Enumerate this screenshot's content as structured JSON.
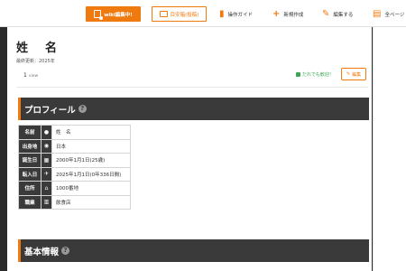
{
  "toolbar": {
    "wiki_label": "wiki編集中!",
    "notice_label": "目安箱(投稿)",
    "guide_label": "操作ガイド",
    "new_label": "新規作成",
    "edit_label": "編集する",
    "all_pages_label": "全ページ"
  },
  "page": {
    "title": "姓　名",
    "updated": "最終更新：2025年",
    "views_count": "1",
    "views_unit": "view",
    "anyone_label": "だれでも歓迎！",
    "edit_button": "編集"
  },
  "sections": {
    "profile_title": "プロフィール",
    "basic_title": "基本情報"
  },
  "profile": {
    "rows": [
      {
        "label": "名前",
        "icon": "person-icon",
        "value": "姓　名"
      },
      {
        "label": "出身地",
        "icon": "location-pin-icon",
        "value": "日本"
      },
      {
        "label": "誕生日",
        "icon": "calendar-icon",
        "value": "2000年1月1日(25歳)"
      },
      {
        "label": "転入日",
        "icon": "airplane-icon",
        "value": "2025年1月1日(0年336日間)"
      },
      {
        "label": "住所",
        "icon": "home-icon",
        "value": "1000番地"
      },
      {
        "label": "職業",
        "icon": "building-icon",
        "value": "飲食店"
      }
    ]
  },
  "colors": {
    "accent": "#ef7a10",
    "header_bg": "#3a3a3a",
    "ok_green": "#3aa757"
  }
}
